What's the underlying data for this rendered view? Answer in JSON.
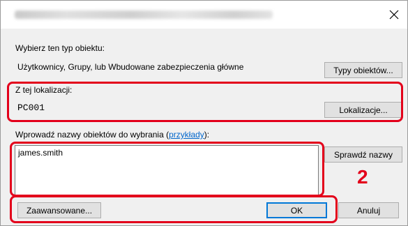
{
  "window": {
    "close_icon": "close-icon"
  },
  "object_type": {
    "label": "Wybierz ten typ obiektu:",
    "value": "Użytkownicy, Grupy, lub Wbudowane zabezpieczenia główne",
    "button": "Typy obiektów..."
  },
  "location": {
    "label": "Z tej lokalizacji:",
    "value": "PC001",
    "button": "Lokalizacje..."
  },
  "names": {
    "label_prefix": "Wprowadź nazwy obiektów do wybrania (",
    "label_link": "przykłady",
    "label_suffix": "):",
    "value": "james.smith",
    "check_button": "Sprawdź nazwy"
  },
  "footer": {
    "advanced_button": "Zaawansowane...",
    "ok_button": "OK",
    "cancel_button": "Anuluj"
  },
  "annotation": {
    "step_number": "2",
    "highlight_color": "#e3001b"
  }
}
